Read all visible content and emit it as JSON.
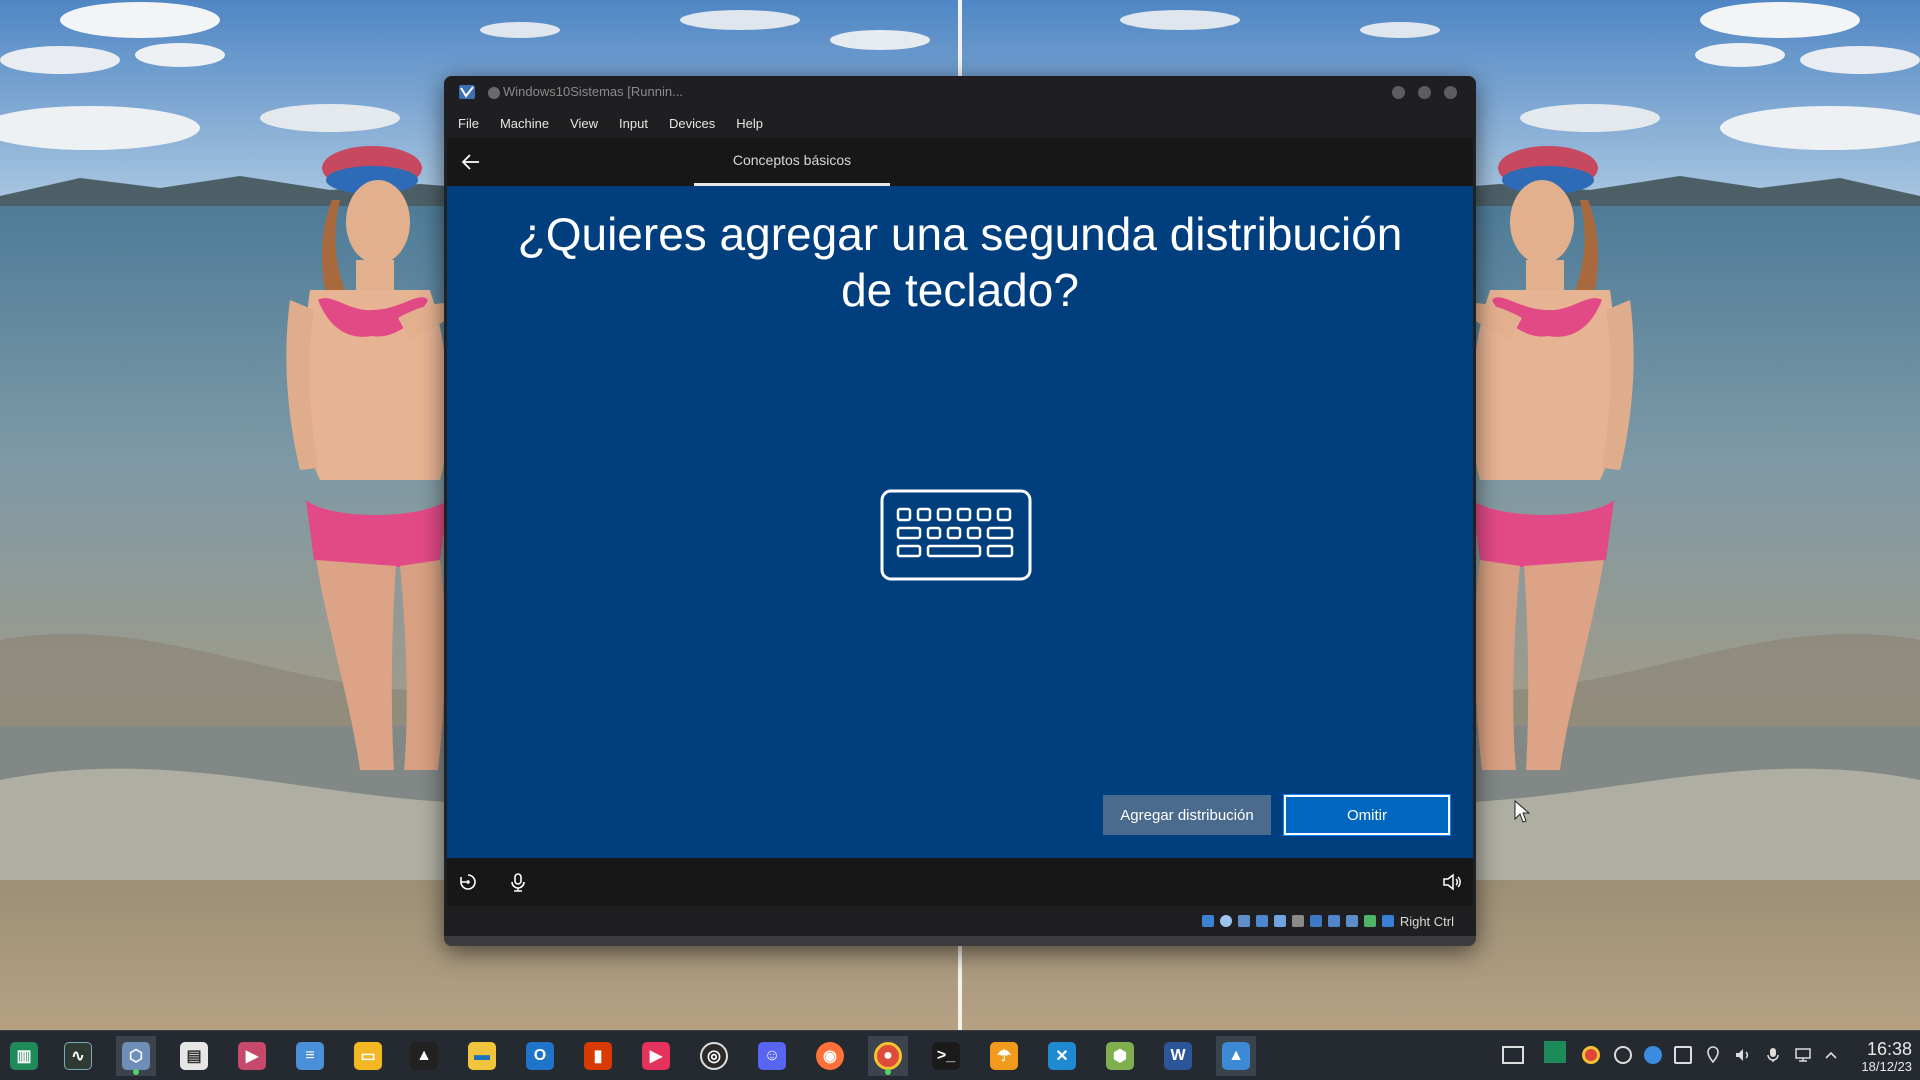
{
  "vm_window": {
    "title": "Windows10Sistemas [Runnin...",
    "menu": [
      "File",
      "Machine",
      "View",
      "Input",
      "Devices",
      "Help"
    ],
    "host_key_label": "Right Ctrl"
  },
  "oobe": {
    "tab": "Conceptos básicos",
    "question": "¿Quieres agregar una segunda distribución de teclado?",
    "add_button": "Agregar distribución",
    "skip_button": "Omitir",
    "illustration_icon": "keyboard-icon",
    "footer_icons": [
      "ease-of-access-icon",
      "microphone-icon",
      "volume-icon"
    ]
  },
  "taskbar": {
    "apps": [
      "menu-launcher",
      "system-monitor",
      "virtualbox",
      "software-store",
      "video-player",
      "notes",
      "file-manager",
      "file-explorer",
      "outlook",
      "office",
      "media-player",
      "obs-studio",
      "discord",
      "firefox",
      "chrome",
      "terminal",
      "drive-backup",
      "vscode",
      "3d-app",
      "word",
      "image-viewer"
    ],
    "clock_time": "16:38",
    "clock_date": "18/12/23"
  },
  "colors": {
    "oobe_background": "#003e7e",
    "primary_button": "#0067c0",
    "secondary_button": "#4a6a8e",
    "taskbar": "#252a30"
  }
}
